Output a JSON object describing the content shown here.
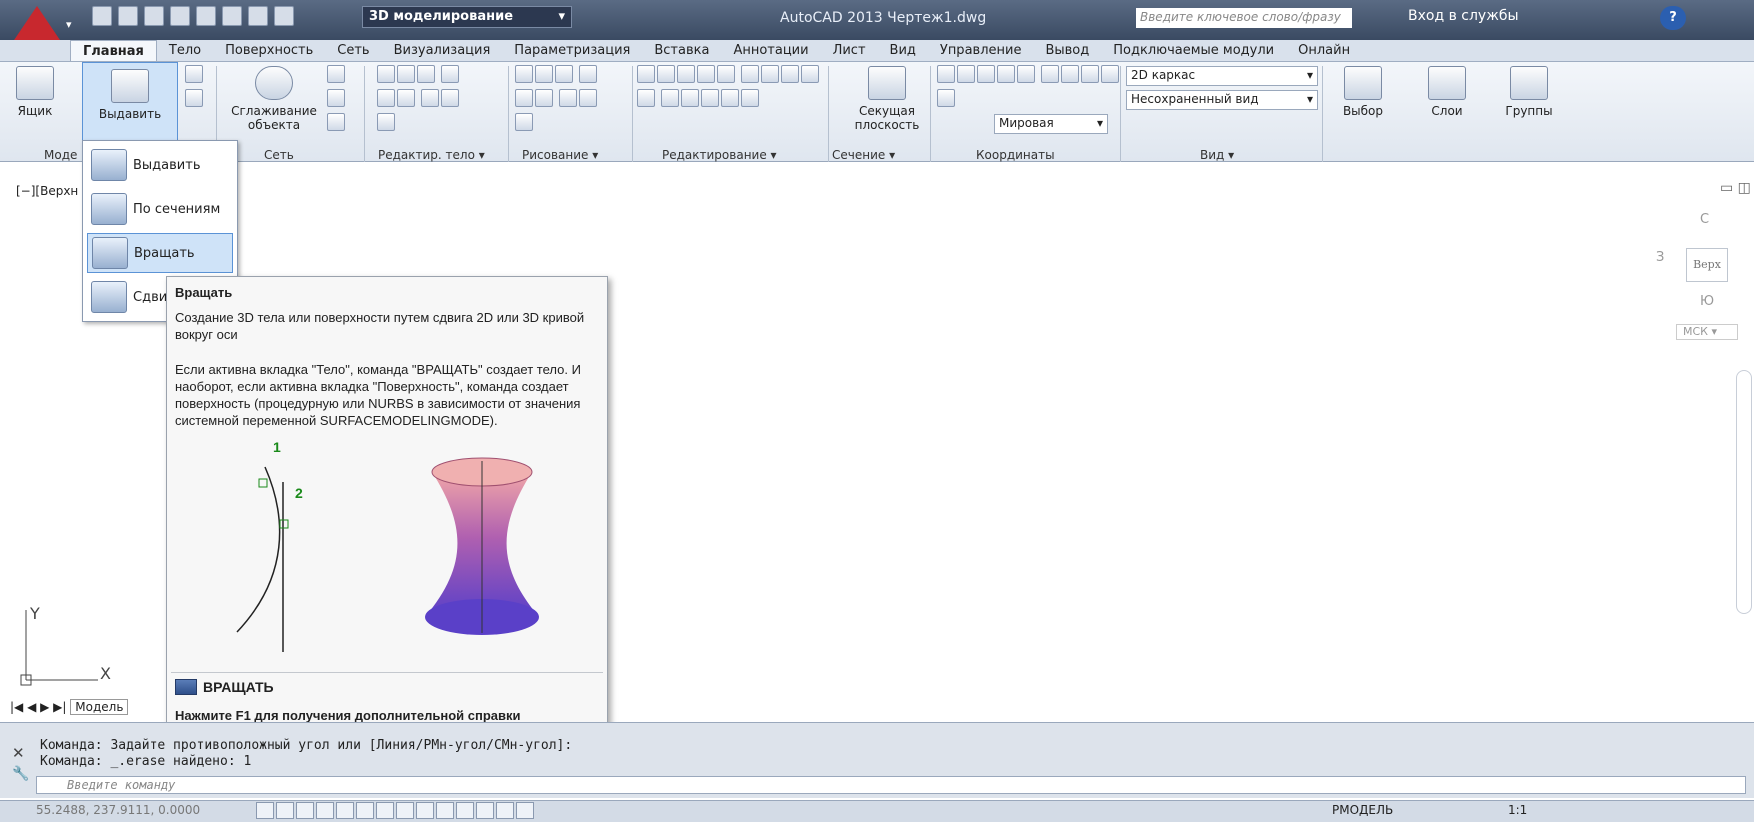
{
  "titlebar": {
    "workspace": "3D моделирование",
    "app_title": "AutoCAD 2013    Чертеж1.dwg",
    "search_placeholder": "Введите ключевое слово/фразу",
    "signin": "Вход в службы"
  },
  "tabs": [
    "Главная",
    "Тело",
    "Поверхность",
    "Сеть",
    "Визуализация",
    "Параметризация",
    "Вставка",
    "Аннотации",
    "Лист",
    "Вид",
    "Управление",
    "Вывод",
    "Подключаемые модули",
    "Онлайн"
  ],
  "ribbon": {
    "box_label": "Ящик",
    "extrude_label": "Выдавить",
    "smooth_label": "Сглаживание объекта",
    "section_plane_label": "Секущая плоскость",
    "visual_style": "2D каркас",
    "view": "Несохраненный вид",
    "world": "Мировая",
    "select_label": "Выбор",
    "layers_label": "Слои",
    "groups_label": "Группы",
    "panels": [
      "Моде",
      "Сеть",
      "Редактир. тело ▾",
      "Рисование ▾",
      "Редактирование ▾",
      "Сечение ▾",
      "Координаты",
      "Вид ▾"
    ]
  },
  "viewport": {
    "label": "[−][Верхн",
    "nav_top": "С",
    "nav_face": "Верх",
    "nav_left": "З",
    "nav_bottom": "Ю",
    "ucs_name": "МСК"
  },
  "dropdown": {
    "items": [
      "Выдавить",
      "По сечениям",
      "Вращать",
      "Сдви"
    ]
  },
  "tooltip": {
    "title": "Вращать",
    "p1": "Создание 3D тела или поверхности путем сдвига 2D или 3D кривой вокруг оси",
    "p2": "Если активна вкладка \"Тело\", команда \"ВРАЩАТЬ\" создает тело. И наоборот, если активна вкладка \"Поверхность\", команда создает поверхность (процедурную или NURBS в зависимости от значения системной переменной SURFACEMODELINGMODE).",
    "label_1": "1",
    "label_2": "2",
    "command": "ВРАЩАТЬ",
    "f1_hint": "Нажмите F1 для получения дополнительной справки"
  },
  "model_tabs": "Модель",
  "command_line": {
    "line1": "Команда: Задайте противоположный угол или [Линия/РМн-угол/СМн-угол]:",
    "line2": "Команда: _.erase найдено: 1",
    "placeholder": "Введите команду"
  },
  "status": {
    "coords": "55.2488, 237.9111, 0.0000",
    "model": "РМОДЕЛЬ",
    "scale": "1:1"
  },
  "colors": {
    "accent": "#c8282e",
    "surface_top": "#e8a0a8",
    "surface_bottom": "#5a40c8"
  }
}
